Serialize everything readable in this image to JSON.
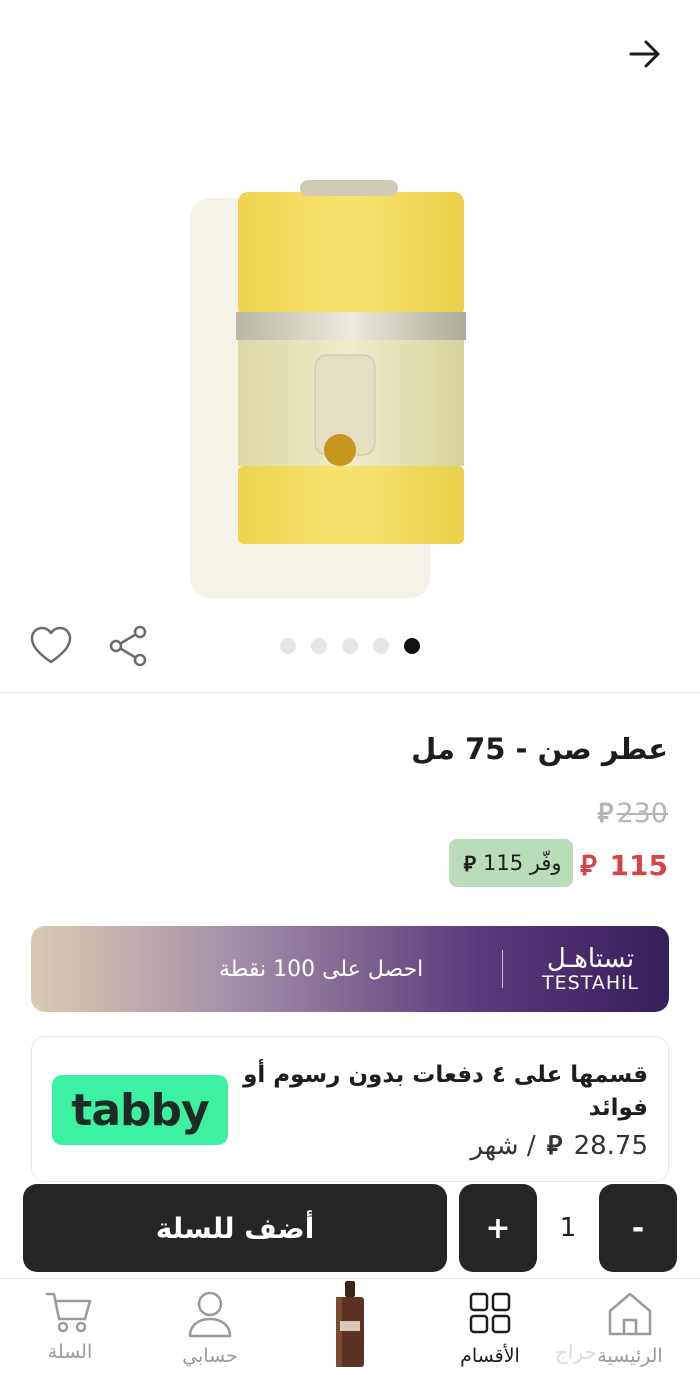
{
  "product": {
    "title": "عطر صن - 75 مل",
    "old_price": "230",
    "new_price": "115",
    "save_label": "وفّر 115",
    "currency_symbol": "⃁",
    "image_count": 5,
    "active_image": 5
  },
  "points_banner": {
    "text": "احصل على 100 نقطة",
    "brand_ar": "تستاهـل",
    "brand_en": "TESTAHiL"
  },
  "tabby": {
    "logo_text": "tabby",
    "description": "قسمها على ٤ دفعات بدون رسوم أو فوائد",
    "monthly_amount": "28.75",
    "monthly_suffix": "/ شهر"
  },
  "cart": {
    "add_label": "أضف للسلة",
    "quantity": "1",
    "plus_label": "+",
    "minus_label": "-"
  },
  "bottom_nav": {
    "cart": "السلة",
    "account": "حسابي",
    "categories": "الأقسام",
    "home": "الرئيسية"
  },
  "watermark": "حراج",
  "colors": {
    "accent_dark": "#262626",
    "sale_red": "#d64545",
    "save_badge_bg": "#b9ddb8",
    "tabby_green": "#3df1a3",
    "banner_purple": "#35205a"
  },
  "icons": [
    "arrow-right-icon",
    "heart-icon",
    "share-icon",
    "cart-icon",
    "user-icon",
    "grid-icon",
    "home-icon"
  ]
}
